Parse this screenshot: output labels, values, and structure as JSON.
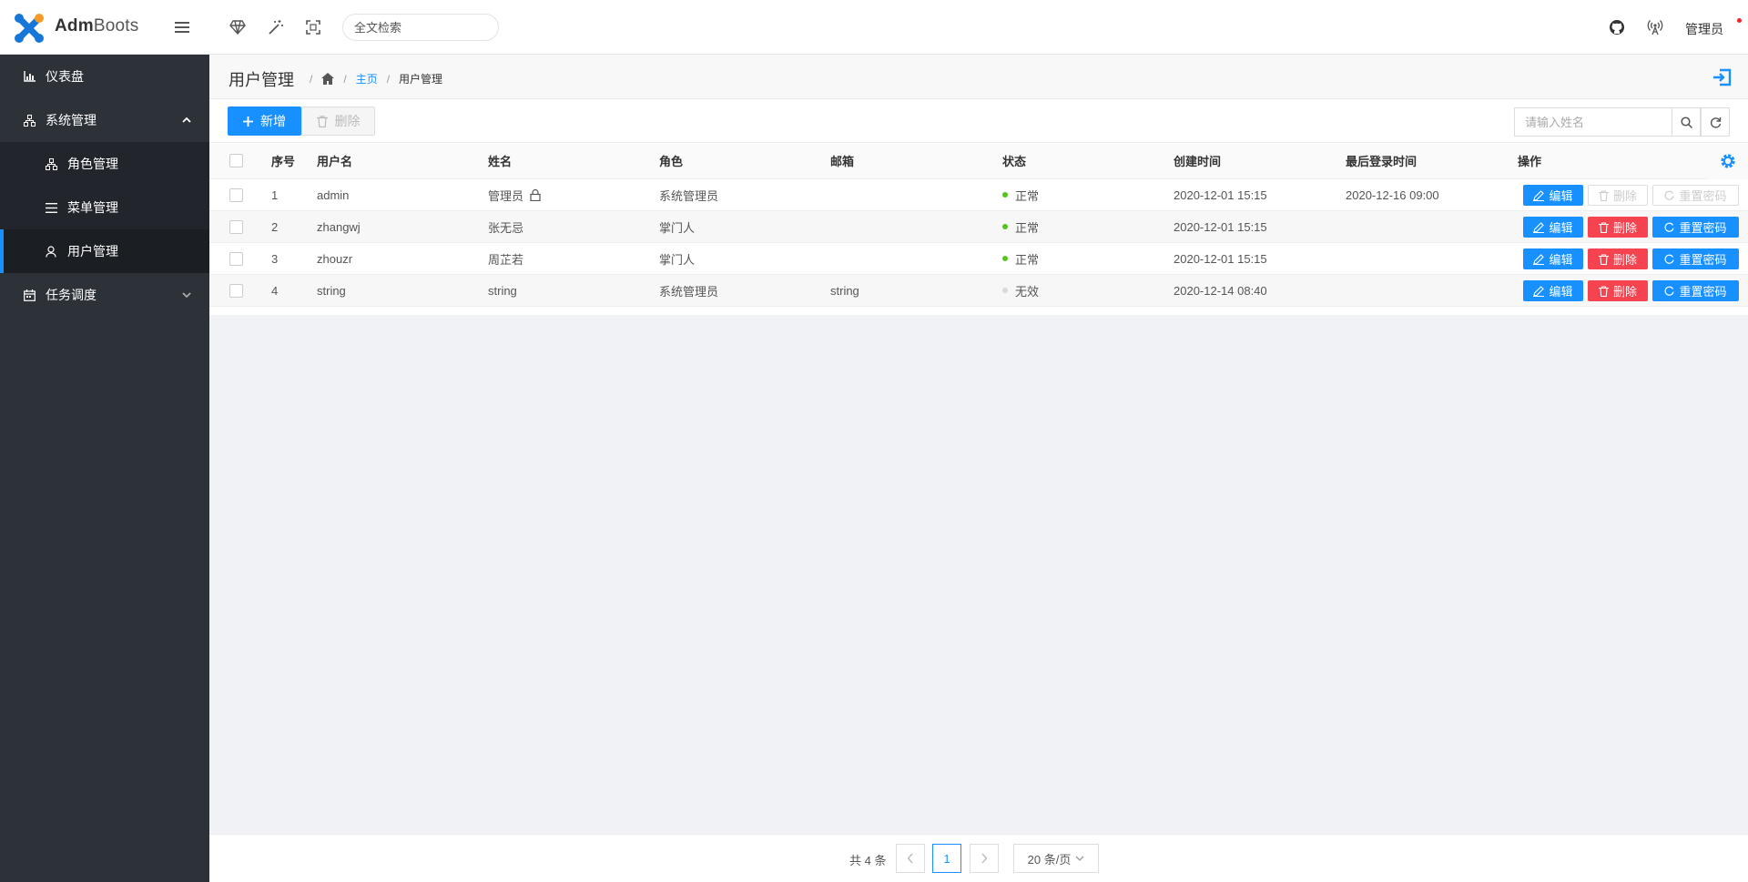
{
  "app": {
    "name_bold": "Adm",
    "name_rest": "Boots"
  },
  "topbar": {
    "search_placeholder": "全文检索",
    "user": "管理员",
    "icons": [
      "menu-icon",
      "diamond-icon",
      "magic-wand-icon",
      "fullscreen-icon",
      "github-icon",
      "broadcast-icon"
    ]
  },
  "sidebar": {
    "items": [
      {
        "label": "仪表盘",
        "icon": "chart-icon"
      },
      {
        "label": "系统管理",
        "icon": "org-icon",
        "expanded": true
      },
      {
        "label": "任务调度",
        "icon": "calendar-icon",
        "expanded": false
      }
    ],
    "sub_items": [
      {
        "label": "角色管理",
        "icon": "org-icon"
      },
      {
        "label": "菜单管理",
        "icon": "list-icon"
      },
      {
        "label": "用户管理",
        "icon": "user-icon",
        "active": true
      }
    ],
    "accent": "#1890ff"
  },
  "page": {
    "title": "用户管理",
    "breadcrumb": {
      "home_link": "主页",
      "current": "用户管理"
    }
  },
  "toolbar": {
    "add_label": "新增",
    "delete_label": "删除",
    "search_placeholder": "请输入姓名"
  },
  "table": {
    "columns": [
      "序号",
      "用户名",
      "姓名",
      "角色",
      "邮箱",
      "状态",
      "创建时间",
      "最后登录时间",
      "操作"
    ],
    "rows": [
      {
        "index": "1",
        "username": "admin",
        "name": "管理员",
        "locked": true,
        "role": "系统管理员",
        "email": "",
        "status": "正常",
        "status_color": "#52c41a",
        "created": "2020-12-01 15:15",
        "last_login": "2020-12-16 09:00",
        "ops_disabled": true
      },
      {
        "index": "2",
        "username": "zhangwj",
        "name": "张无忌",
        "locked": false,
        "role": "掌门人",
        "email": "",
        "status": "正常",
        "status_color": "#52c41a",
        "created": "2020-12-01 15:15",
        "last_login": "",
        "ops_disabled": false
      },
      {
        "index": "3",
        "username": "zhouzr",
        "name": "周芷若",
        "locked": false,
        "role": "掌门人",
        "email": "",
        "status": "正常",
        "status_color": "#52c41a",
        "created": "2020-12-01 15:15",
        "last_login": "",
        "ops_disabled": false
      },
      {
        "index": "4",
        "username": "string",
        "name": "string",
        "locked": false,
        "role": "系统管理员",
        "email": "string",
        "status": "无效",
        "status_color": "#d9d9d9",
        "created": "2020-12-14 08:40",
        "last_login": "",
        "ops_disabled": false
      }
    ],
    "ops": {
      "edit": "编辑",
      "delete": "删除",
      "reset": "重置密码"
    }
  },
  "pagination": {
    "total_label": "共 4 条",
    "current_page": "1",
    "page_size": "20 条/页"
  }
}
